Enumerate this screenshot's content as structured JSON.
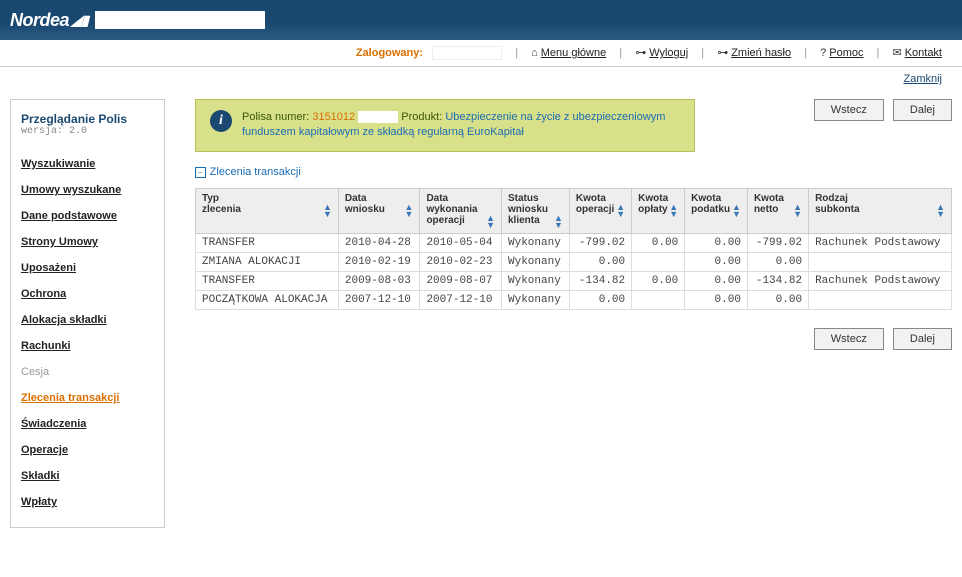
{
  "brand": "Nordea",
  "topbar": {
    "logged_label": "Zalogowany:",
    "menu": "Menu główne",
    "logout": "Wyloguj",
    "change_pw": "Zmień hasło",
    "help": "Pomoc",
    "contact": "Kontakt"
  },
  "close": "Zamknij",
  "sidebar": {
    "title": "Przeglądanie Polis",
    "version": "wersja: 2.0",
    "items": [
      {
        "label": "Wyszukiwanie",
        "active": false,
        "disabled": false
      },
      {
        "label": "Umowy wyszukane",
        "active": false,
        "disabled": false
      },
      {
        "label": "Dane podstawowe",
        "active": false,
        "disabled": false
      },
      {
        "label": "Strony Umowy",
        "active": false,
        "disabled": false
      },
      {
        "label": "Uposażeni",
        "active": false,
        "disabled": false
      },
      {
        "label": "Ochrona",
        "active": false,
        "disabled": false
      },
      {
        "label": "Alokacja składki",
        "active": false,
        "disabled": false
      },
      {
        "label": "Rachunki",
        "active": false,
        "disabled": false
      },
      {
        "label": "Cesja",
        "active": false,
        "disabled": true
      },
      {
        "label": "Zlecenia transakcji",
        "active": true,
        "disabled": false
      },
      {
        "label": "Świadczenia",
        "active": false,
        "disabled": false
      },
      {
        "label": "Operacje",
        "active": false,
        "disabled": false
      },
      {
        "label": "Składki",
        "active": false,
        "disabled": false
      },
      {
        "label": "Wpłaty",
        "active": false,
        "disabled": false
      }
    ]
  },
  "buttons": {
    "back": "Wstecz",
    "next": "Dalej"
  },
  "info": {
    "label_policy": "Polisa numer:",
    "policy_no": "3151012",
    "label_product": "Produkt:",
    "product": "Ubezpieczenie na życie z ubezpieczeniowym funduszem kapitałowym ze składką regularną EuroKapitał"
  },
  "section": "Zlecenia transakcji",
  "table": {
    "headers": [
      "Typ zlecenia",
      "Data wniosku",
      "Data wykonania operacji",
      "Status wniosku klienta",
      "Kwota operacji",
      "Kwota opłaty",
      "Kwota podatku",
      "Kwota netto",
      "Rodzaj subkonta"
    ],
    "rows": [
      {
        "c": [
          "TRANSFER",
          "2010-04-28",
          "2010-05-04",
          "Wykonany",
          "-799.02",
          "0.00",
          "0.00",
          "-799.02",
          "Rachunek Podstawowy"
        ]
      },
      {
        "c": [
          "ZMIANA ALOKACJI",
          "2010-02-19",
          "2010-02-23",
          "Wykonany",
          "0.00",
          "",
          "0.00",
          "0.00",
          ""
        ]
      },
      {
        "c": [
          "TRANSFER",
          "2009-08-03",
          "2009-08-07",
          "Wykonany",
          "-134.82",
          "0.00",
          "0.00",
          "-134.82",
          "Rachunek Podstawowy"
        ]
      },
      {
        "c": [
          "POCZĄTKOWA ALOKACJA",
          "2007-12-10",
          "2007-12-10",
          "Wykonany",
          "0.00",
          "",
          "0.00",
          "0.00",
          ""
        ]
      }
    ]
  }
}
